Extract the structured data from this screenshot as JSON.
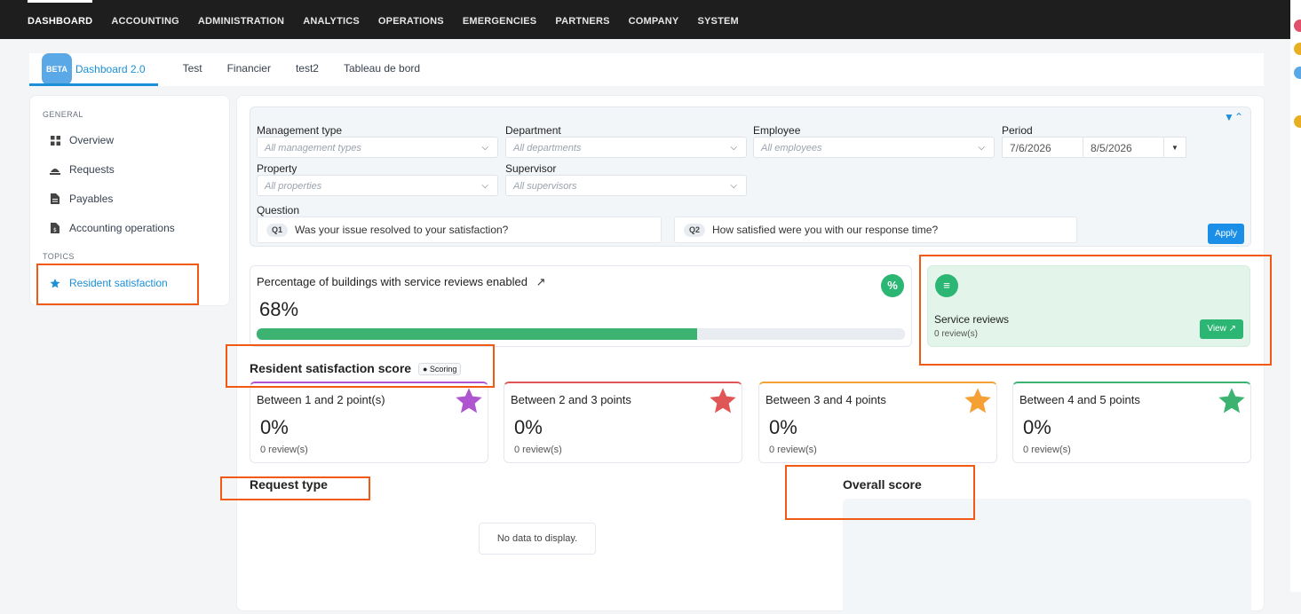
{
  "topnav": {
    "items": [
      "DASHBOARD",
      "ACCOUNTING",
      "ADMINISTRATION",
      "ANALYTICS",
      "OPERATIONS",
      "EMERGENCIES",
      "PARTNERS",
      "COMPANY",
      "SYSTEM"
    ]
  },
  "tabs": {
    "beta_badge": "BETA",
    "items": [
      "Dashboard 2.0",
      "Test",
      "Financier",
      "test2",
      "Tableau de bord"
    ]
  },
  "sidebar": {
    "general_label": "GENERAL",
    "items": [
      "Overview",
      "Requests",
      "Payables",
      "Accounting operations"
    ],
    "topics_label": "TOPICS",
    "topic_item": "Resident satisfaction"
  },
  "filters": {
    "management_type": {
      "label": "Management type",
      "placeholder": "All management types"
    },
    "department": {
      "label": "Department",
      "placeholder": "All departments"
    },
    "employee": {
      "label": "Employee",
      "placeholder": "All employees"
    },
    "period": {
      "label": "Period",
      "start": "7/6/2026",
      "end": "8/5/2026"
    },
    "property": {
      "label": "Property",
      "placeholder": "All properties"
    },
    "supervisor": {
      "label": "Supervisor",
      "placeholder": "All supervisors"
    },
    "question_label": "Question",
    "questions": [
      {
        "tag": "Q1",
        "text": "Was your issue resolved to your satisfaction?"
      },
      {
        "tag": "Q2",
        "text": "How satisfied were you with our response time?"
      }
    ],
    "apply_label": "Apply"
  },
  "kpi": {
    "title": "Percentage of buildings with service reviews enabled",
    "value": "68%",
    "progress": 0.68
  },
  "service_reviews": {
    "title": "Service reviews",
    "subtitle": "0 review(s)",
    "view_label": "View"
  },
  "satisfaction": {
    "title": "Resident satisfaction score",
    "scoring_label": "Scoring",
    "cards": [
      {
        "title": "Between 1 and 2 point(s)",
        "value": "0%",
        "sub": "0 review(s)",
        "color": "#b055d0"
      },
      {
        "title": "Between 2 and 3 points",
        "value": "0%",
        "sub": "0 review(s)",
        "color": "#e05555"
      },
      {
        "title": "Between 3 and 4 points",
        "value": "0%",
        "sub": "0 review(s)",
        "color": "#f5a035"
      },
      {
        "title": "Between 4 and 5 points",
        "value": "0%",
        "sub": "0 review(s)",
        "color": "#3cb371"
      }
    ]
  },
  "request_type": {
    "title": "Request type",
    "no_data": "No data to display."
  },
  "overall_score": {
    "title": "Overall score"
  }
}
